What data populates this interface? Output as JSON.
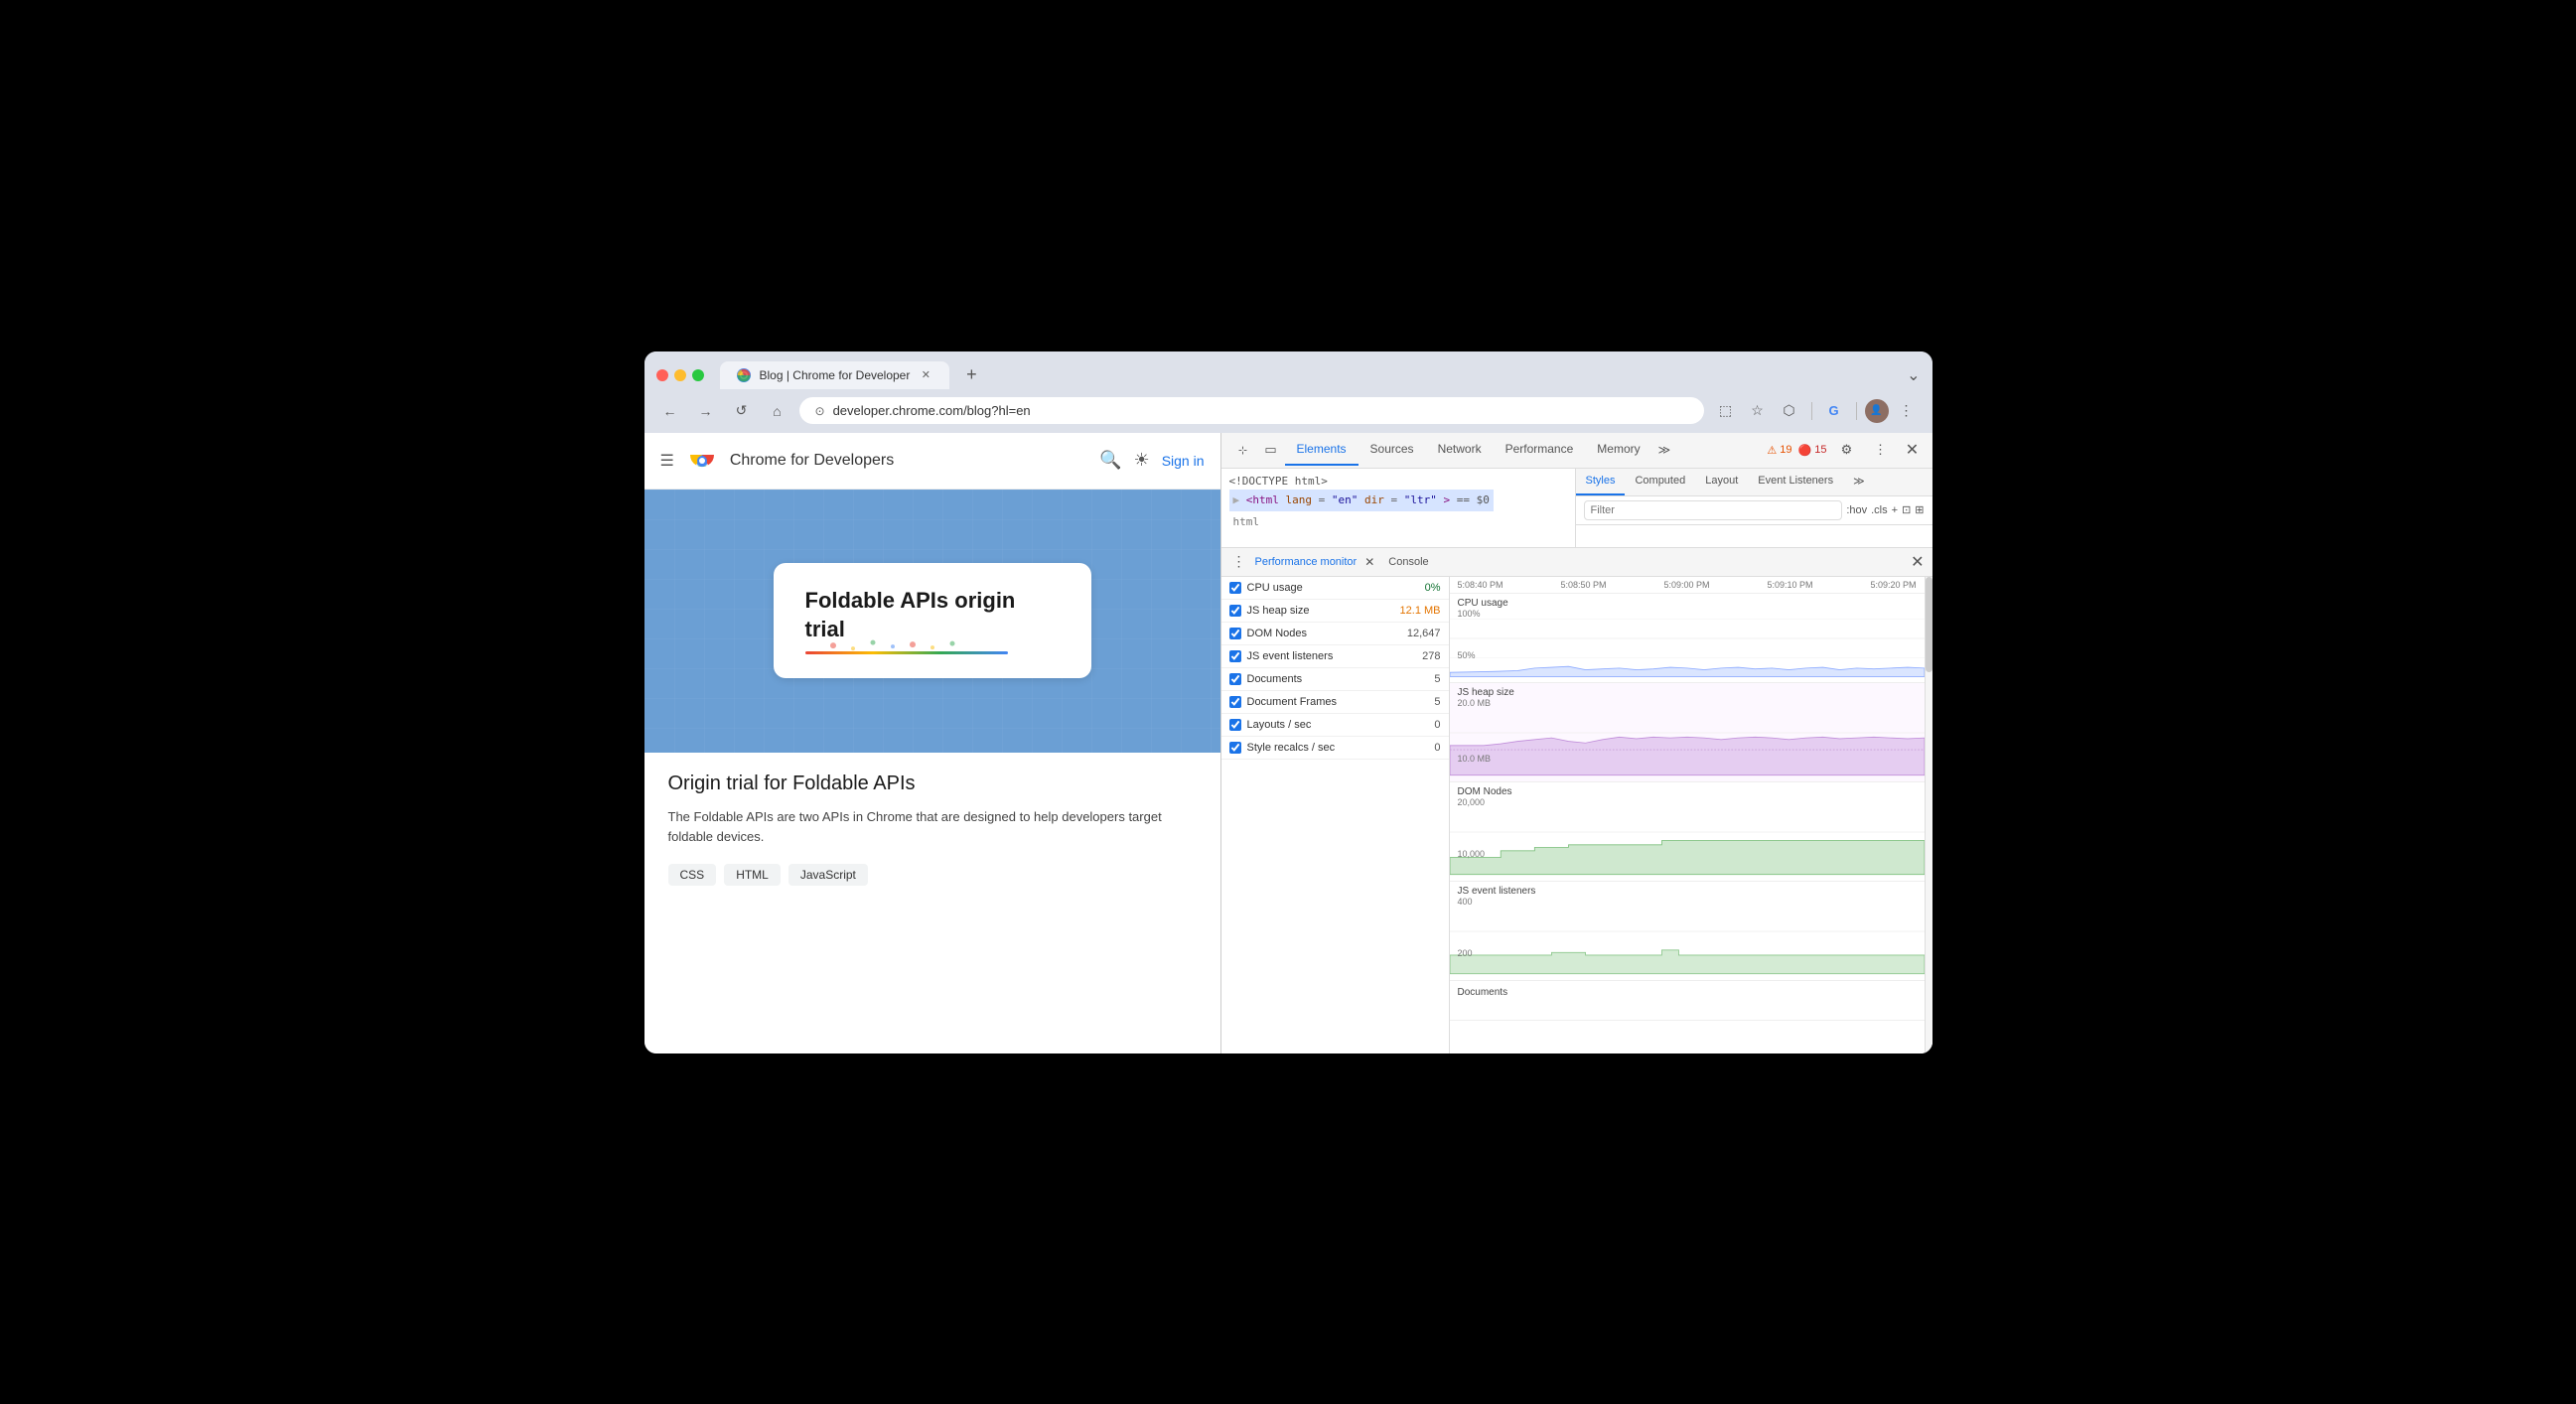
{
  "browser": {
    "tab_title": "Blog | Chrome for Developer",
    "tab_url": "developer.chrome.com/blog?hl=en",
    "new_tab_label": "+",
    "more_label": "⌄"
  },
  "nav": {
    "back_label": "←",
    "forward_label": "→",
    "reload_label": "↺",
    "home_label": "⌂",
    "address": "developer.chrome.com/blog?hl=en"
  },
  "webpage": {
    "header": {
      "menu_label": "☰",
      "site_name": "Chrome for Developers",
      "sign_in": "Sign in"
    },
    "post": {
      "card_title": "Foldable APIs origin trial",
      "article_title": "Origin trial for Foldable APIs",
      "description": "The Foldable APIs are two APIs in Chrome that are designed to help developers target foldable devices.",
      "tags": [
        "CSS",
        "HTML",
        "JavaScript"
      ]
    }
  },
  "devtools": {
    "tabs": [
      {
        "label": "Elements",
        "active": true
      },
      {
        "label": "Sources",
        "active": false
      },
      {
        "label": "Network",
        "active": false
      },
      {
        "label": "Performance",
        "active": false
      },
      {
        "label": "Memory",
        "active": false
      }
    ],
    "more_tabs": "≫",
    "warnings": "19",
    "errors": "15",
    "elements_panel": {
      "line1": "<!DOCTYPE html>",
      "line2": "<html lang=\"en\" dir=\"ltr\"> == $0",
      "line3": "html"
    },
    "styles_tabs": [
      {
        "label": "Styles",
        "active": true
      },
      {
        "label": "Computed",
        "active": false
      },
      {
        "label": "Layout",
        "active": false
      },
      {
        "label": "Event Listeners",
        "active": false
      }
    ],
    "styles_filter_placeholder": "Filter",
    "styles_filter_actions": [
      ":hov",
      ".cls",
      "+"
    ]
  },
  "perf_monitor": {
    "title": "Performance monitor",
    "console_tab": "Console",
    "metrics": [
      {
        "label": "CPU usage",
        "value": "0%",
        "color": "green",
        "checked": true
      },
      {
        "label": "JS heap size",
        "value": "12.1 MB",
        "color": "orange",
        "checked": true
      },
      {
        "label": "DOM Nodes",
        "value": "12,647",
        "color": "",
        "checked": true
      },
      {
        "label": "JS event listeners",
        "value": "278",
        "color": "",
        "checked": true
      },
      {
        "label": "Documents",
        "value": "5",
        "color": "",
        "checked": true
      },
      {
        "label": "Document Frames",
        "value": "5",
        "color": "",
        "checked": true
      },
      {
        "label": "Layouts / sec",
        "value": "0",
        "color": "",
        "checked": true
      },
      {
        "label": "Style recalcs / sec",
        "value": "0",
        "color": "",
        "checked": true
      }
    ],
    "timeline": {
      "labels": [
        "5:08:40 PM",
        "5:08:50 PM",
        "5:09:00 PM",
        "5:09:10 PM",
        "5:09:20 PM"
      ]
    },
    "charts": [
      {
        "label": "CPU usage",
        "sublabel": "100%",
        "sublabel2": "50%",
        "color": "rgba(100,150,255,0.4)",
        "height": 80
      },
      {
        "label": "JS heap size",
        "sublabel": "20.0 MB",
        "sublabel2": "10.0 MB",
        "color": "rgba(200,150,220,0.5)",
        "height": 80
      },
      {
        "label": "DOM Nodes",
        "sublabel": "20,000",
        "sublabel2": "10,000",
        "color": "rgba(150,200,150,0.5)",
        "height": 80
      },
      {
        "label": "JS event listeners",
        "sublabel": "400",
        "sublabel2": "200",
        "color": "rgba(150,200,150,0.5)",
        "height": 80
      },
      {
        "label": "Documents",
        "sublabel": "",
        "sublabel2": "",
        "color": "rgba(150,200,150,0.5)",
        "height": 40
      }
    ]
  }
}
